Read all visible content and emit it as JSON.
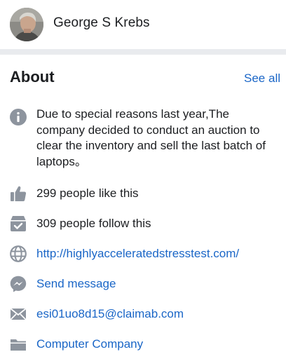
{
  "header": {
    "page_name": "George S Krebs",
    "avatar_icon": "profile-photo"
  },
  "about": {
    "title": "About",
    "see_all": "See all",
    "rows": [
      {
        "icon": "info-icon",
        "text": "Due to special reasons last year,The company decided to conduct an auction to clear the inventory and sell the last batch of laptops。"
      },
      {
        "icon": "thumbs-up-icon",
        "text": "299 people like this"
      },
      {
        "icon": "follow-icon",
        "text": "309 people follow this"
      },
      {
        "icon": "globe-icon",
        "text": "http://highlyacceleratedstresstest.com/"
      },
      {
        "icon": "messenger-icon",
        "text": "Send message"
      },
      {
        "icon": "mail-icon",
        "text": "esi01uo8d15@claimab.com"
      },
      {
        "icon": "category-icon",
        "text": "Computer Company"
      }
    ]
  },
  "colors": {
    "link": "#1a66c7",
    "icon": "#8d949e",
    "divider": "#e9ebee",
    "text": "#1c1e21"
  }
}
